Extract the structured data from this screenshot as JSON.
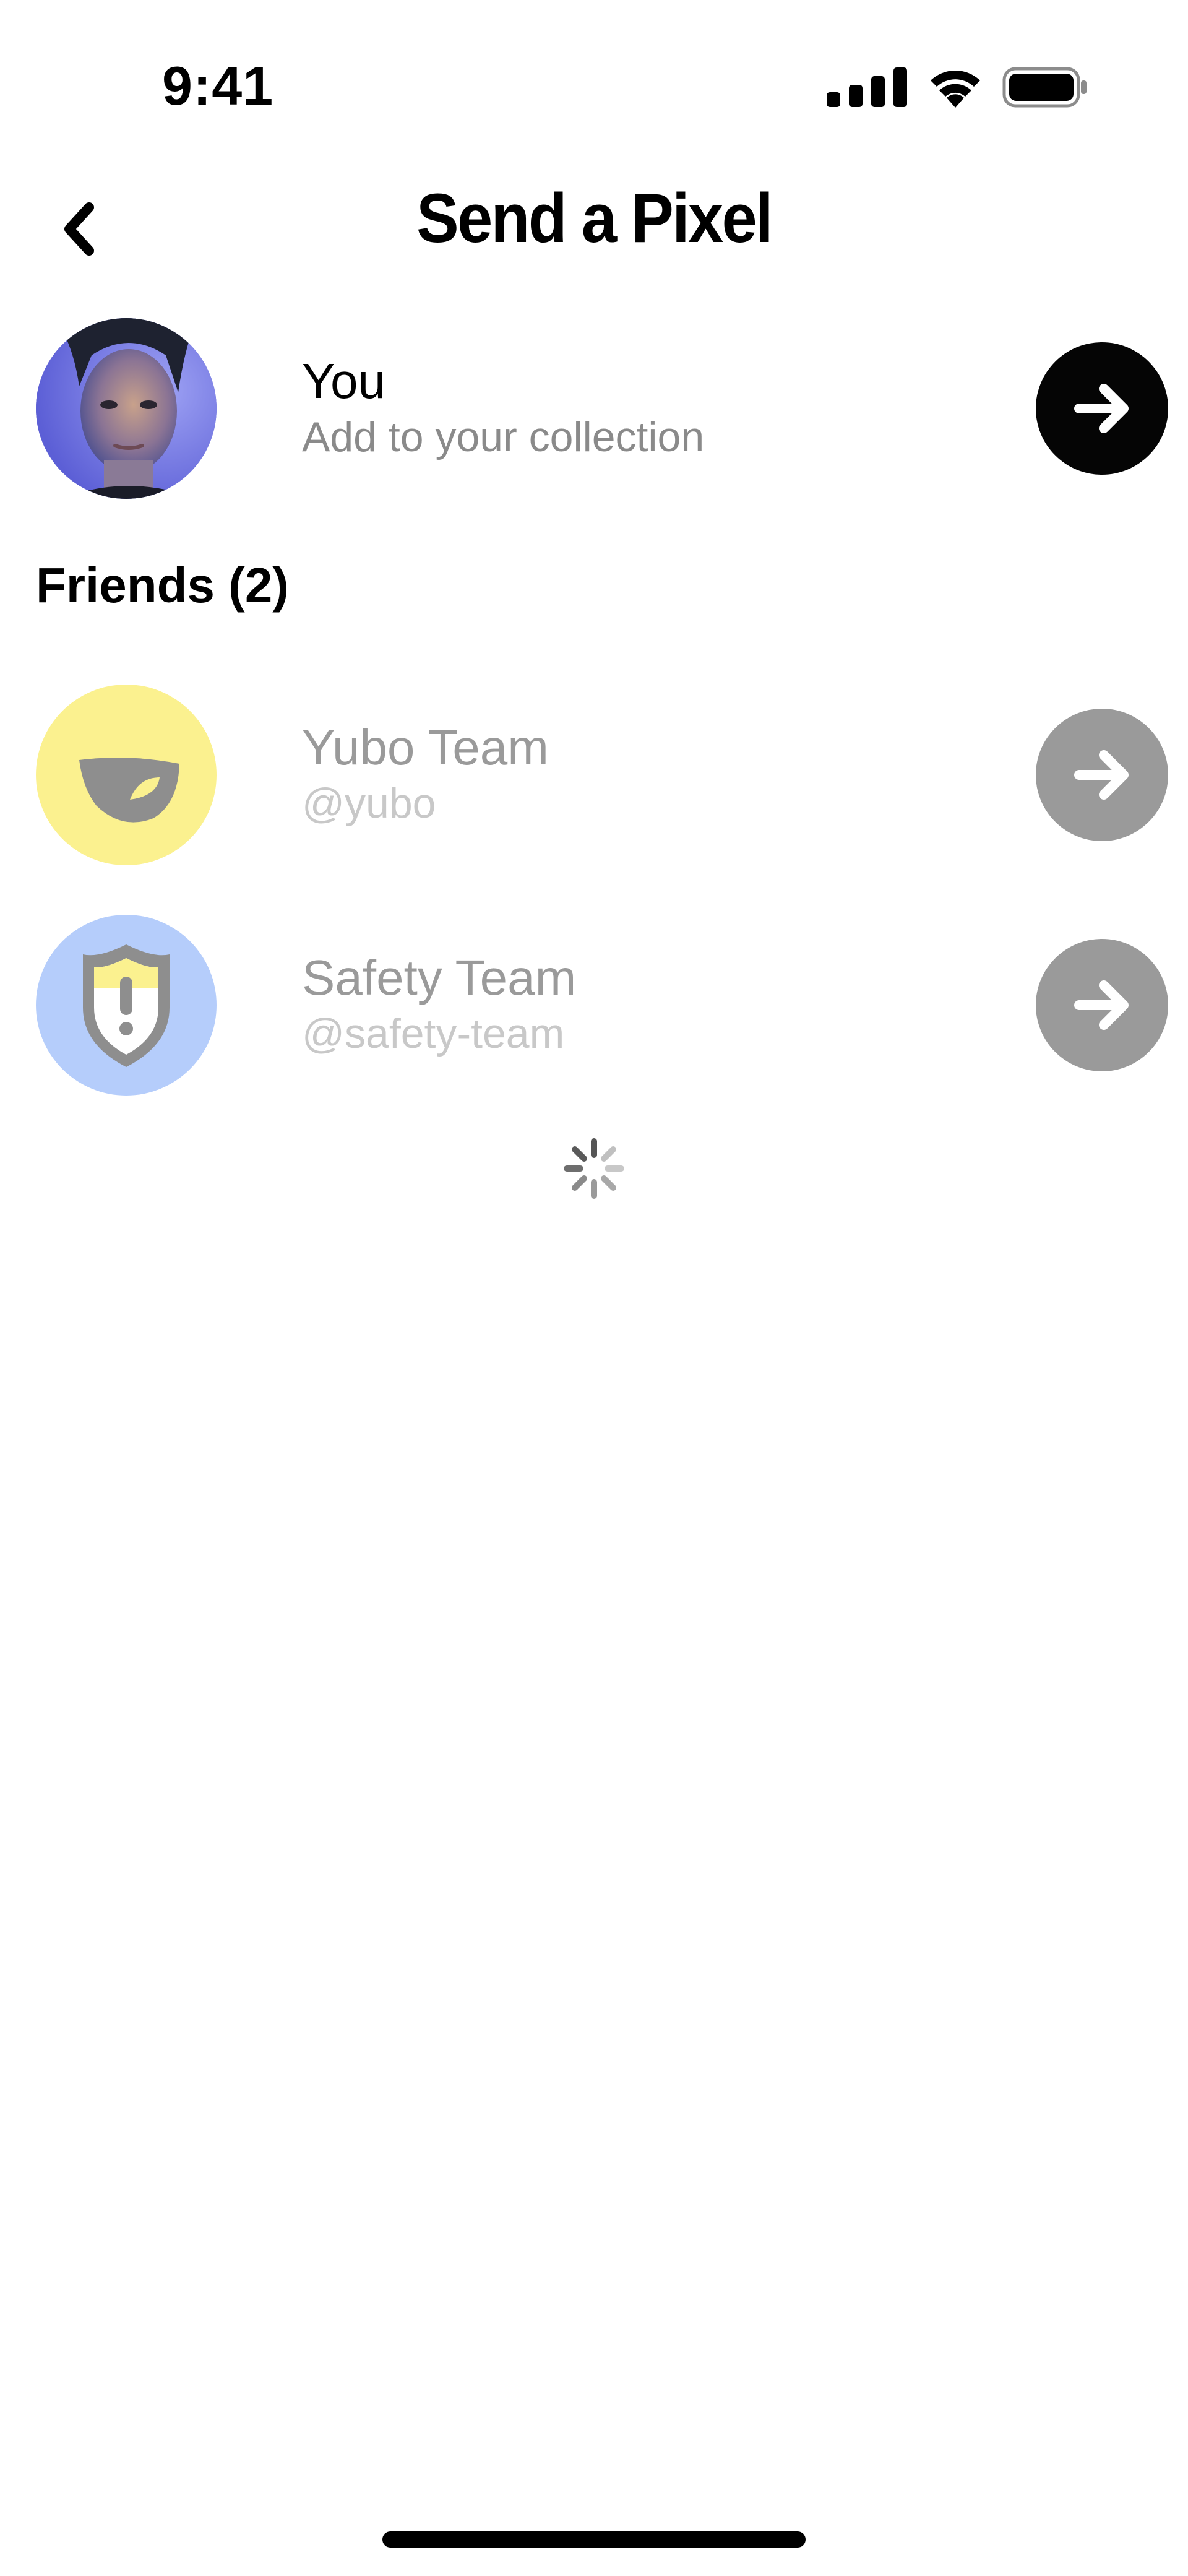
{
  "status_bar": {
    "time": "9:41"
  },
  "header": {
    "title": "Send a Pixel"
  },
  "self_row": {
    "name": "You",
    "subtitle": "Add to your collection"
  },
  "friends": {
    "section_title": "Friends (2)",
    "items": [
      {
        "name": "Yubo Team",
        "handle": "@yubo",
        "avatar_color": "#fbf18f"
      },
      {
        "name": "Safety Team",
        "handle": "@safety-team",
        "avatar_color": "#b5cdfb"
      }
    ]
  },
  "icons": {
    "back": "chevron-left-icon",
    "send": "arrow-right-icon",
    "signal": "signal-icon",
    "wifi": "wifi-icon",
    "battery": "battery-icon",
    "loading": "spinner-icon"
  },
  "colors": {
    "primary_button": "#050505",
    "disabled_button": "#9a9a9a",
    "disabled_text": "#9a9a9a",
    "disabled_subtext": "#c8c8c8"
  }
}
